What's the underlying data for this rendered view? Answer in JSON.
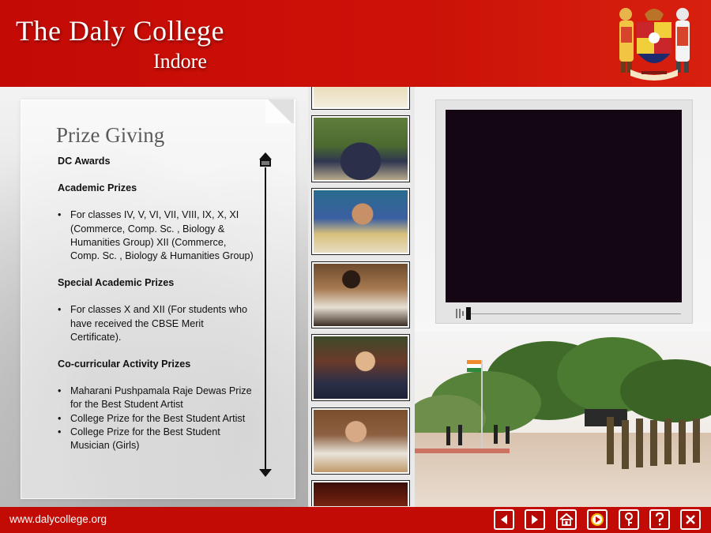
{
  "header": {
    "title": "The Daly College",
    "subtitle": "Indore"
  },
  "section": {
    "heading": "Prize Giving",
    "blocks": [
      {
        "title": "DC Awards",
        "items": []
      },
      {
        "title": "Academic Prizes",
        "items": [
          "For classes IV, V, VI, VII, VIII, IX, X, XI (Commerce, Comp. Sc. , Biology & Humanities Group) XII (Commerce, Comp. Sc. , Biology & Humanities Group)"
        ]
      },
      {
        "title": "Special Academic Prizes",
        "items": [
          "For classes X and XII (For students who have received the CBSE Merit Certificate)."
        ]
      },
      {
        "title": "Co-curricular Activity Prizes",
        "items": [
          "Maharani Pushpamala Raje Dewas Prize for the Best Student Artist",
          "College Prize for the Best Student Artist",
          "College Prize for the Best Student Musician (Girls)"
        ]
      }
    ]
  },
  "footer": {
    "url": "www.dalycollege.org",
    "buttons": [
      "back-button",
      "forward-button",
      "home-button",
      "play-button",
      "help-key-button",
      "question-button",
      "close-button"
    ]
  },
  "colors": {
    "brand_red": "#c30b05",
    "video_screen": "#150613",
    "accent_gold": "#f4b400"
  }
}
